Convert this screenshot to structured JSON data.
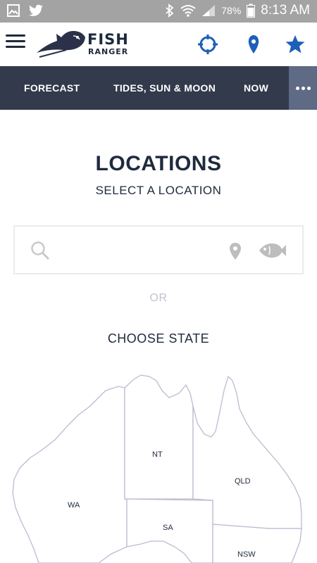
{
  "status_bar": {
    "battery_percent": "78%",
    "time": "8:13 AM"
  },
  "header": {
    "logo_line1": "FISH",
    "logo_line2": "RANGER",
    "icons": [
      "menu-icon",
      "crosshair-icon",
      "map-pin-icon",
      "star-icon"
    ],
    "accent_color": "#1d5fb8"
  },
  "tabs": [
    {
      "label": "FORECAST"
    },
    {
      "label": "TIDES, SUN & MOON"
    },
    {
      "label": "NOW"
    }
  ],
  "page": {
    "title": "LOCATIONS",
    "subtitle": "SELECT A LOCATION",
    "search": {
      "value": "",
      "placeholder": ""
    },
    "or_text": "OR",
    "choose_state": "CHOOSE STATE"
  },
  "map": {
    "states": [
      {
        "code": "WA"
      },
      {
        "code": "NT"
      },
      {
        "code": "QLD"
      },
      {
        "code": "SA"
      },
      {
        "code": "NSW"
      }
    ]
  }
}
